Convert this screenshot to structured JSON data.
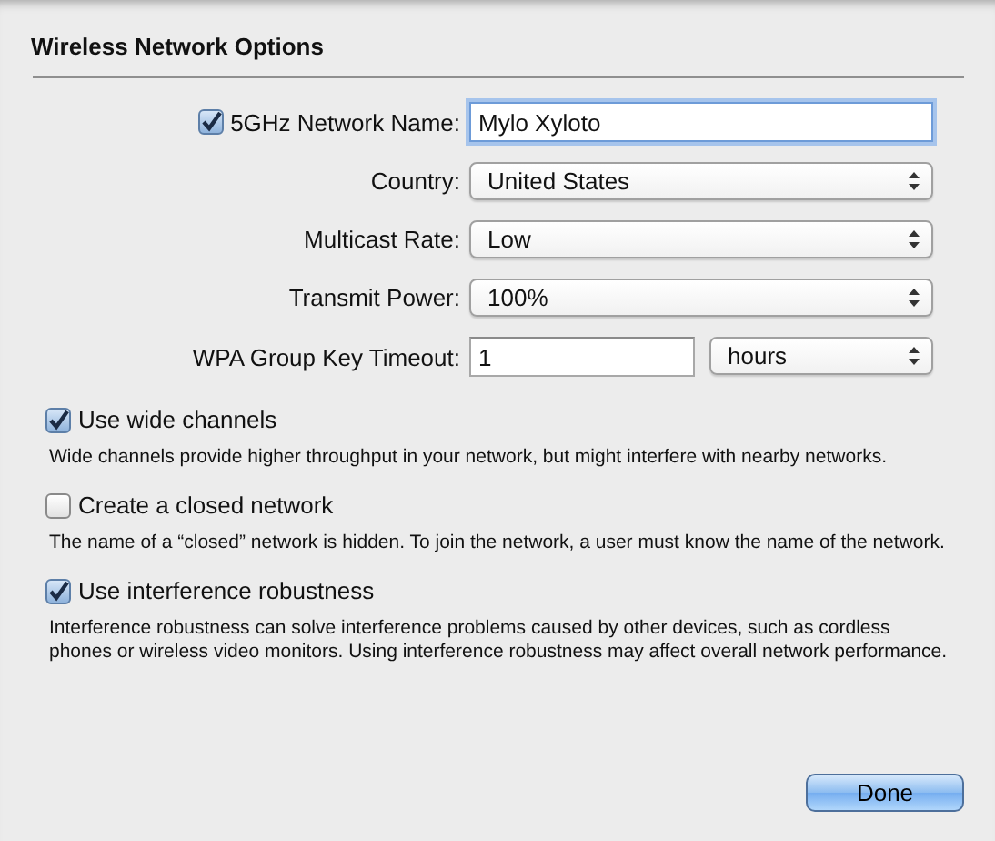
{
  "sheet": {
    "title": "Wireless Network Options"
  },
  "fields": [
    {
      "kind": "text",
      "label": "5GHz Network Name:",
      "checked": true,
      "value": "Mylo Xyloto",
      "focused": true
    },
    {
      "kind": "select",
      "label": "Country:",
      "value": "United States"
    },
    {
      "kind": "select",
      "label": "Multicast Rate:",
      "value": "Low"
    },
    {
      "kind": "select",
      "label": "Transmit Power:",
      "value": "100%"
    },
    {
      "kind": "timeout",
      "label": "WPA Group Key Timeout:",
      "value": "1",
      "unit": "hours"
    }
  ],
  "options": [
    {
      "label": "Use wide channels",
      "checked": true,
      "description": "Wide channels provide higher throughput in your network, but might interfere with nearby networks."
    },
    {
      "label": "Create a closed network",
      "checked": false,
      "description": "The name of a “closed” network is hidden. To join the network, a user must know the name of the network."
    },
    {
      "label": "Use interference robustness",
      "checked": true,
      "description": "Interference robustness can solve interference problems caused by other devices, such as cordless phones or wireless video monitors. Using interference robustness may affect overall network performance."
    }
  ],
  "buttons": [
    {
      "label": "Done",
      "default": true
    }
  ]
}
